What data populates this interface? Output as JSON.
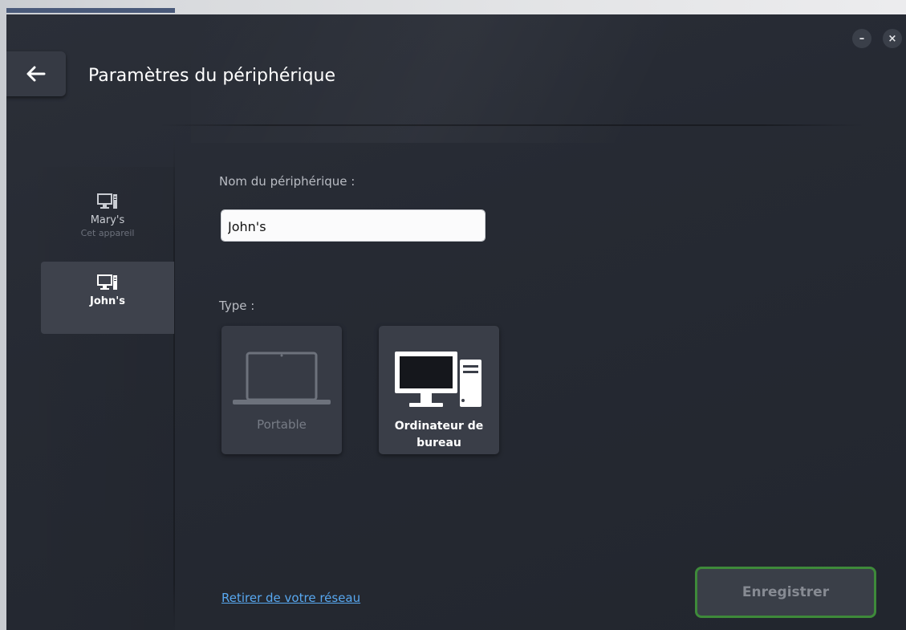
{
  "window": {
    "title": "Paramètres du périphérique",
    "minimize_icon": "minimize-icon",
    "close_icon": "close-icon",
    "minimize_glyph": "–",
    "close_glyph": "×"
  },
  "back_button": {
    "icon": "arrow-left-icon"
  },
  "sidebar": {
    "devices": [
      {
        "name": "Mary's",
        "subtitle": "Cet appareil",
        "icon": "desktop-computer-icon",
        "active": false
      },
      {
        "name": "John's",
        "icon": "desktop-computer-icon",
        "active": true
      }
    ]
  },
  "form": {
    "name_label": "Nom du périphérique :",
    "name_value": "John's",
    "type_label": "Type :",
    "types": [
      {
        "label": "Portable",
        "icon": "laptop-icon",
        "selected": false
      },
      {
        "label": "Ordinateur de\nbureau",
        "label_line1": "Ordinateur de",
        "label_line2": "bureau",
        "icon": "desktop-computer-icon",
        "selected": true
      }
    ]
  },
  "footer": {
    "remove_link": "Retirer de votre réseau",
    "save_label": "Enregistrer"
  },
  "colors": {
    "background": "#262a33",
    "card": "#373b45",
    "link": "#58a8f0",
    "save_border": "#3e8a3a"
  }
}
